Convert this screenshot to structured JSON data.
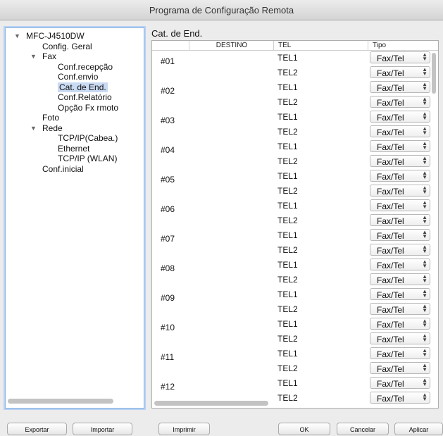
{
  "window": {
    "title": "Programa de Configuração Remota"
  },
  "tree": {
    "items": [
      {
        "label": "MFC-J4510DW",
        "level": 0,
        "expanded": true
      },
      {
        "label": "Config. Geral",
        "level": 1
      },
      {
        "label": "Fax",
        "level": 1,
        "expanded": true
      },
      {
        "label": "Conf.recepção",
        "level": 2
      },
      {
        "label": "Conf.envio",
        "level": 2
      },
      {
        "label": "Cat. de End.",
        "level": 2,
        "selected": true
      },
      {
        "label": "Conf.Relatório",
        "level": 2
      },
      {
        "label": "Opção Fx rmoto",
        "level": 2
      },
      {
        "label": "Foto",
        "level": 1
      },
      {
        "label": "Rede",
        "level": 1,
        "expanded": true
      },
      {
        "label": "TCP/IP(Cabea.)",
        "level": 2
      },
      {
        "label": "Ethernet",
        "level": 2
      },
      {
        "label": "TCP/IP (WLAN)",
        "level": 2
      },
      {
        "label": "Conf.inicial",
        "level": 1
      }
    ]
  },
  "main": {
    "section_title": "Cat. de End.",
    "columns": {
      "destino": "DESTINO",
      "tel": "TEL",
      "tipo": "Tipo"
    },
    "entries": [
      "#01",
      "#02",
      "#03",
      "#04",
      "#05",
      "#06",
      "#07",
      "#08",
      "#09",
      "#10",
      "#11",
      "#12"
    ],
    "tel_labels": [
      "TEL1",
      "TEL2"
    ],
    "tipo_value": "Fax/Tel"
  },
  "buttons": {
    "exportar": "Exportar",
    "importar": "Importar",
    "imprimir": "Imprimir",
    "ok": "OK",
    "cancelar": "Cancelar",
    "aplicar": "Aplicar"
  },
  "icons": {
    "disclosure": "triangle-down-icon",
    "popup_arrows": "up-down-arrows-icon"
  }
}
